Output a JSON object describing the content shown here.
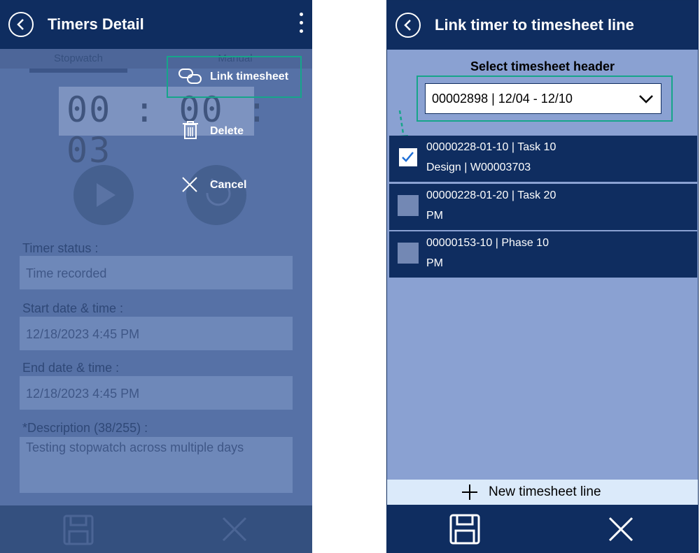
{
  "left_screen": {
    "title": "Timers Detail",
    "tabs": [
      "Stopwatch",
      "Manual"
    ],
    "timer": "00 : 00 : 03",
    "fields": [
      {
        "label": "Timer status :",
        "value": "Time recorded"
      },
      {
        "label": "Start date & time :",
        "value": "12/18/2023 4:45 PM"
      },
      {
        "label": "End date & time :",
        "value": "12/18/2023 4:45 PM"
      },
      {
        "label": "*Description (38/255) :",
        "value": "Testing stopwatch across multiple days"
      }
    ],
    "menu": {
      "link": "Link timesheet",
      "delete": "Delete",
      "cancel": "Cancel"
    },
    "icons": [
      "back-icon",
      "more-icon",
      "link-icon",
      "trash-icon",
      "close-icon",
      "play-icon",
      "reset-icon",
      "save-icon"
    ]
  },
  "right_screen": {
    "title": "Link timer to timesheet line",
    "select_label": "Select timesheet header",
    "select_value": "00002898 | 12/04 - 12/10",
    "lines": [
      {
        "line1": "00000228-01-10 | Task 10",
        "line2": "Design | W00003703",
        "checked": true
      },
      {
        "line1": "00000228-01-20 | Task 20",
        "line2": "PM",
        "checked": false
      },
      {
        "line1": "00000153-10 | Phase 10",
        "line2": "PM",
        "checked": false
      }
    ],
    "new_line": "New timesheet line",
    "icons": [
      "back-icon",
      "chevron-down-icon",
      "checkmark-icon",
      "plus-icon",
      "save-icon",
      "close-icon"
    ]
  },
  "colors": {
    "header": "#0f2d60",
    "highlight": "#16a58a",
    "right_bg": "#8aa1d2"
  }
}
